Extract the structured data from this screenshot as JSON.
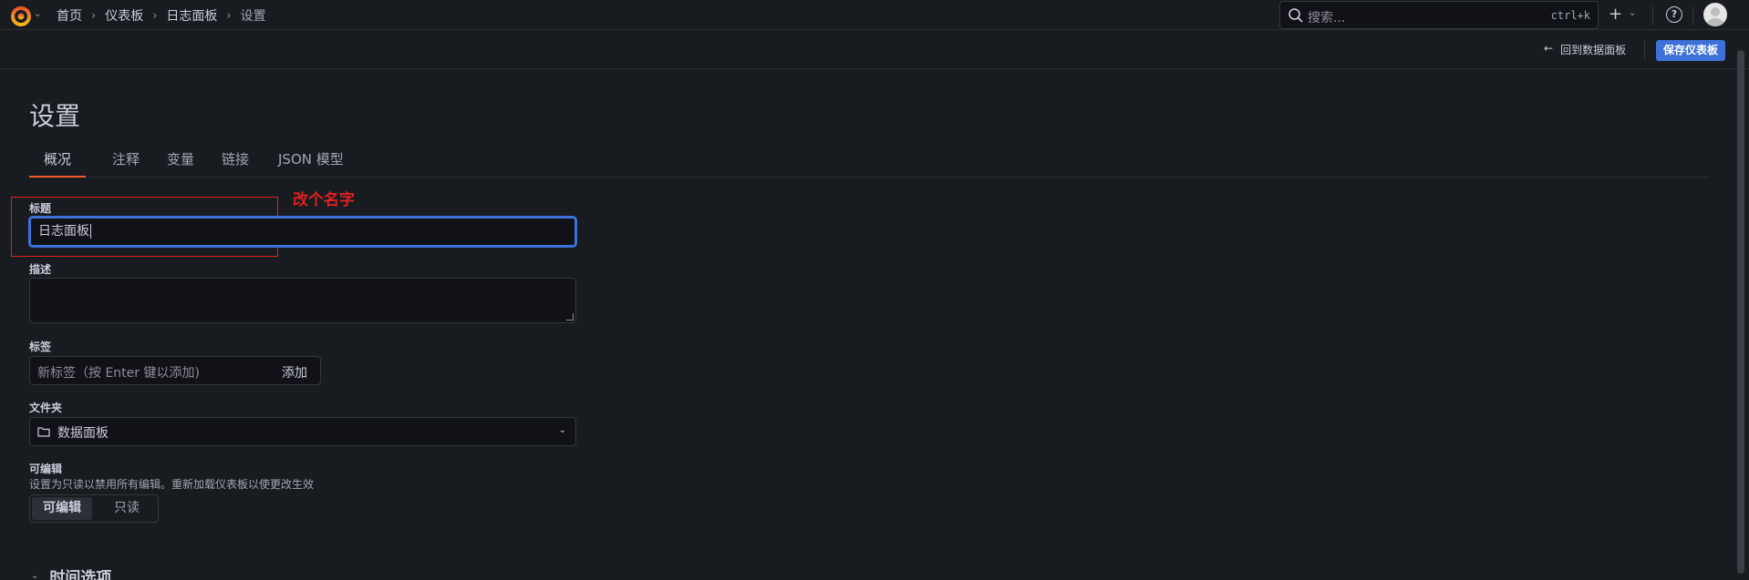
{
  "breadcrumb": {
    "items": [
      "首页",
      "仪表板",
      "日志面板"
    ],
    "current": "设置"
  },
  "search": {
    "placeholder": "搜索...",
    "shortcut": "ctrl+k"
  },
  "toolbar": {
    "back_label": "回到数据面板",
    "save_label": "保存仪表板"
  },
  "page": {
    "title": "设置"
  },
  "tabs": [
    {
      "label": "概况",
      "active": true
    },
    {
      "label": "注释"
    },
    {
      "label": "变量"
    },
    {
      "label": "链接"
    },
    {
      "label": "JSON 模型"
    }
  ],
  "annotation": {
    "text": "改个名字",
    "color": "#e02020"
  },
  "form": {
    "title_label": "标题",
    "title_value": "日志面板",
    "description_label": "描述",
    "tags_label": "标签",
    "tags_placeholder": "新标签（按 Enter 键以添加)",
    "tags_add": "添加",
    "folder_label": "文件夹",
    "folder_value": "数据面板",
    "editable_label": "可编辑",
    "editable_desc": "设置为只读以禁用所有编辑。重新加载仪表板以使更改生效",
    "editable_options": [
      "可编辑",
      "只读"
    ],
    "editable_selected": "可编辑"
  },
  "sections": {
    "time_options": "时间选项"
  },
  "colors": {
    "accent": "#f05a28",
    "primary": "#3d71d9",
    "bg": "#181b1f"
  }
}
